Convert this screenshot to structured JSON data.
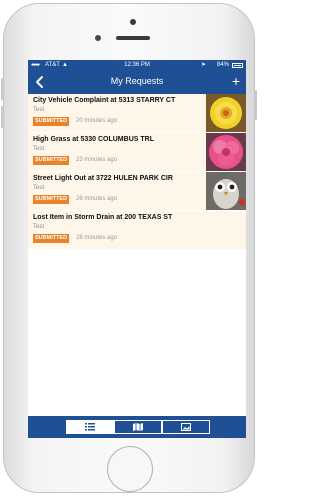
{
  "status_bar": {
    "carrier": "AT&T",
    "time": "12:36 PM",
    "battery": "84%"
  },
  "nav": {
    "title": "My Requests",
    "back_icon": "chevron-left-icon",
    "add_icon": "plus-icon",
    "add_label": "+"
  },
  "requests": [
    {
      "title": "City Vehicle Complaint at 5313 STARRY CT",
      "description": "Test",
      "status": "SUBMITTED",
      "time": "20 minutes ago",
      "thumbnail": "yellow-flower-photo"
    },
    {
      "title": "High Grass at 5330 COLUMBUS TRL",
      "description": "Test",
      "status": "SUBMITTED",
      "time": "23 minutes ago",
      "thumbnail": "pink-flower-photo"
    },
    {
      "title": "Street Light Out at 3722 HULEN PARK CIR",
      "description": "Test",
      "status": "SUBMITTED",
      "time": "26 minutes ago",
      "thumbnail": "owl-photo"
    },
    {
      "title": "Lost Item in Storm Drain at 200 TEXAS ST",
      "description": "Test",
      "status": "SUBMITTED",
      "time": "28 minutes ago",
      "thumbnail": ""
    }
  ],
  "tabs": [
    {
      "icon": "list-icon",
      "active": true
    },
    {
      "icon": "map-icon",
      "active": false
    },
    {
      "icon": "photo-icon",
      "active": false
    }
  ],
  "colors": {
    "header_blue": "#1f4f94",
    "row_background": "#fdf6e9",
    "status_orange": "#e8832a"
  }
}
